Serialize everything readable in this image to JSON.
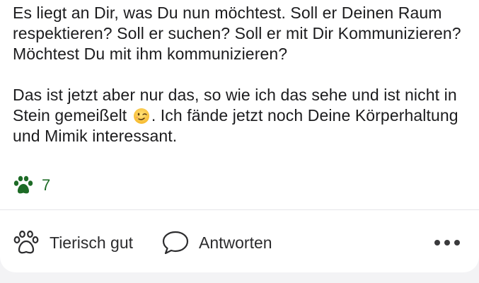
{
  "post": {
    "paragraph1": "Es liegt an Dir, was Du nun möchtest. Soll er Deinen Raum respektieren? Soll er suchen? Soll er mit Dir Kommunizieren? Möchtest Du mit ihm kommunizieren?",
    "paragraph2_before": "Das ist jetzt aber nur das, so wie ich das sehe und ist nicht in Stein gemeißelt",
    "paragraph2_after": ". Ich fände jetzt noch Deine Körperhaltung und Mimik interessant.",
    "emoji": "winking-face-emoji"
  },
  "reactions": {
    "icon": "paw-icon",
    "count": "7",
    "color": "#1d6b26"
  },
  "actions": {
    "like_label": "Tierisch gut",
    "like_icon": "paw-outline-icon",
    "reply_label": "Antworten",
    "reply_icon": "speech-bubble-icon",
    "more_icon": "more-dots-icon"
  }
}
